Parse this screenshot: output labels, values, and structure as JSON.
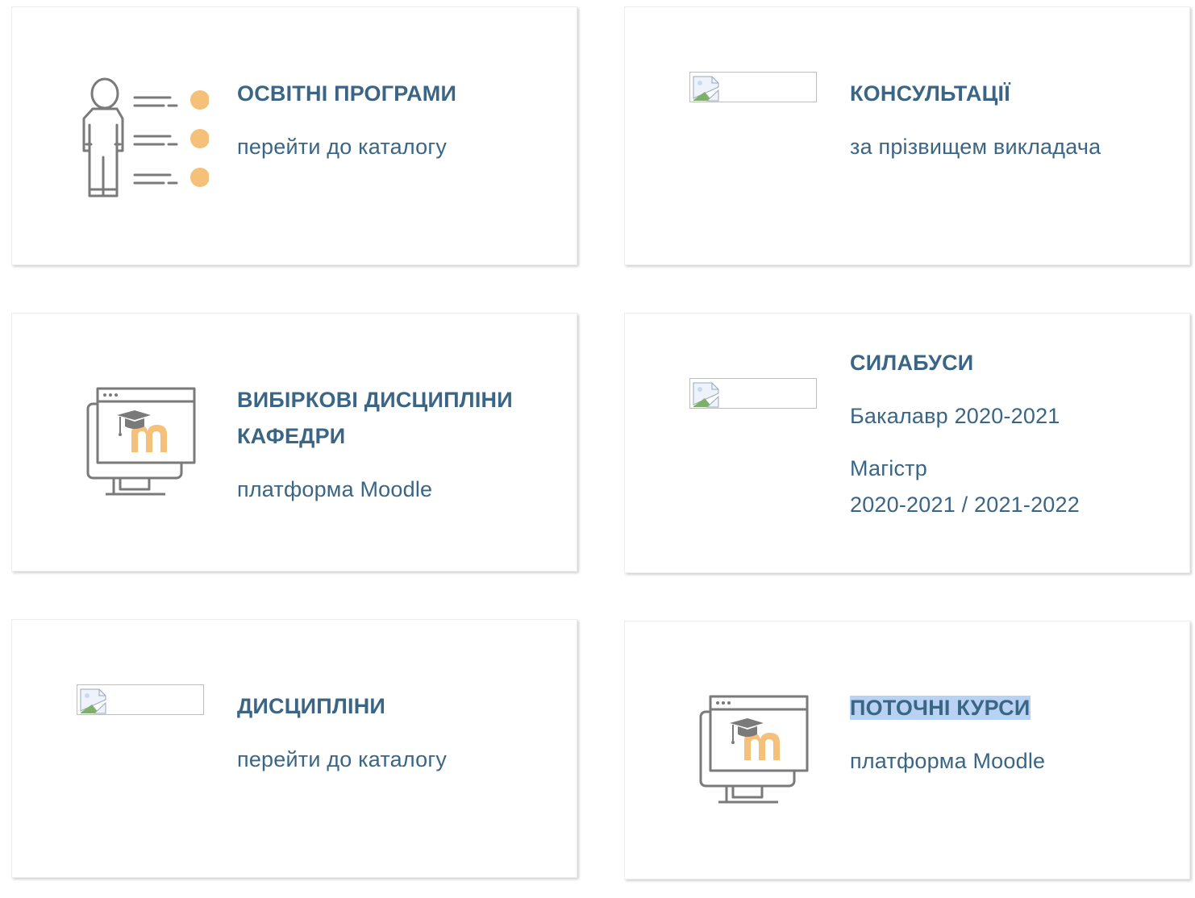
{
  "cards": [
    {
      "title": "ОСВІТНІ ПРОГРАМИ",
      "links": [
        "перейти до каталогу"
      ],
      "icon": "person-list-icon"
    },
    {
      "title": "КОНСУЛЬТАЦІЇ",
      "links": [
        "за прізвищем викладача"
      ],
      "icon": "broken-image-icon"
    },
    {
      "title_lines": [
        "ВИБІРКОВІ ДИСЦИПЛІНИ",
        "КАФЕДРИ"
      ],
      "links": [
        "платформа Moodle"
      ],
      "icon": "moodle-monitor-icon"
    },
    {
      "title": "СИЛАБУСИ",
      "links": [
        "Бакалавр 2020-2021",
        "Магістр",
        "2020-2021 / 2021-2022"
      ],
      "icon": "broken-image-icon"
    },
    {
      "title": "ДИСЦИПЛІНИ",
      "links": [
        "перейти до каталогу"
      ],
      "icon": "broken-image-icon"
    },
    {
      "title": "ПОТОЧНІ КУРСИ",
      "links": [
        "платформа Moodle"
      ],
      "icon": "moodle-monitor-icon",
      "title_selected": true
    }
  ],
  "colors": {
    "text": "#3b6585",
    "icon_gray": "#7a7a7a",
    "accent_orange": "#f5c07a",
    "selection": "#b7d2f2"
  }
}
